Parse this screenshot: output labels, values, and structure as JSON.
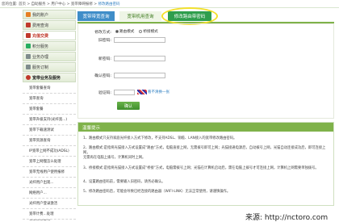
{
  "breadcrumb": {
    "prefix": "您的位置: 首页 > 自助服务 > 用户中心 > 宽带障碍报修 > ",
    "current": "修改路由密码"
  },
  "sidebar": {
    "items": [
      {
        "label": "我的账户",
        "icon_color": "#e67e22"
      },
      {
        "label": "费用查询",
        "icon_color": "#c0392b"
      },
      {
        "label": "充值交费",
        "icon_color": "#c0392b"
      },
      {
        "label": "积分服务",
        "icon_color": "#27ae60"
      },
      {
        "label": "业务办理",
        "icon_color": "#7f8c8d"
      },
      {
        "label": "服务订制",
        "icon_color": "#7f8c8d"
      },
      {
        "label": "宽带业务及服务",
        "icon_color": "#c0392b"
      }
    ],
    "sub_items": [
      "宽带套餐查询",
      "宽带查询",
      "宽带套餐",
      "宽带升级支持(光纤宽...)",
      "宽带下载速测试",
      "宽带资源查询",
      "IP宽带上网不成功(ADSL)",
      "宽带上网慢怎么处理",
      "宽带无线用户使用报修",
      "光纤用户出现...",
      "网络用户...",
      "光纤用户登录激活",
      "宽带计费...处理",
      "宽带业务查询"
    ]
  },
  "tabs": [
    {
      "label": "宽带带宽查询"
    },
    {
      "label": "宽带机用查询"
    },
    {
      "label": "修改路由带密码"
    }
  ],
  "form": {
    "mode_label": "修改方式:",
    "mode_options": [
      "路由模式",
      "桥接模式"
    ],
    "old_password_label": "旧密码:",
    "new_password_label": "新密码:",
    "confirm_password_label": "确认密码:",
    "captcha_label": "验证码:",
    "captcha_refresh": "看不清换一张",
    "submit_label": "确认"
  },
  "tips": {
    "title": "温馨提示",
    "items": [
      "1、路由模式只支持家庭光纤接入方式下修改，不支持ADSL、铜缆、LAN接入的宽带修改路由密码。",
      "2、路由模式:是指将光猫接入方式设置成\"路由\"方式，电脑直接上网，无需拨号即可上网；光猫接通电源后，自动拨号上网，光猫自动连接成功后，即可连接上网，",
      "   无需再在电脑上拨号，计算机同时上网。",
      "3、桥接模式:是指将光猫接入方式设置成\"桥接\"方式，电脑需拨号上网；光猫在计算机启动后，需在电脑上拨号才可连接上网，计算机上网需要单独拨号。",
      "4、设置路由密码前，需要输入旧密码，请务必确认。",
      "5、修改路由密码后，可能会导致已经连接的路由器（WIFI-LINK）无法正常使用，请谨慎操作。"
    ]
  },
  "watermark": "来源: http://nctoro.com"
}
